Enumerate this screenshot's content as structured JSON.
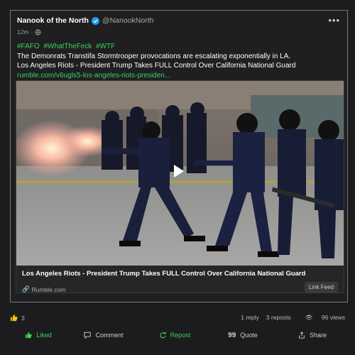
{
  "post": {
    "author_name": "Nanook of the North",
    "author_handle": "@NanookNorth",
    "timestamp": "12m",
    "hashtags": [
      "#FAFO",
      "#WhatTheFeck",
      "#WTF"
    ],
    "line1": "The Demonrats Transtifa Stormtrooper provocations are escalating exponentially in LA.",
    "line2": "Los Angeles Riots - President Trump Takes FULL Control Over California National Guard",
    "link": "rumble.com/v6ugls5-los-angeles-riots-presiden..."
  },
  "card": {
    "title": "Los Angeles Riots - President Trump Takes FULL Control Over California National Guard",
    "source": "Rumble.com",
    "link_feed": "Link Feed"
  },
  "stats": {
    "likes": "3",
    "replies": "1 reply",
    "reposts": "3 reposts",
    "views": "96 views"
  },
  "actions": {
    "like": "Liked",
    "comment": "Comment",
    "repost": "Repost",
    "quote": "Quote",
    "share": "Share"
  },
  "colors": {
    "accent_green": "#3ad35a",
    "verified_blue": "#1d9bf0",
    "like_yellow": "#f5c518"
  }
}
